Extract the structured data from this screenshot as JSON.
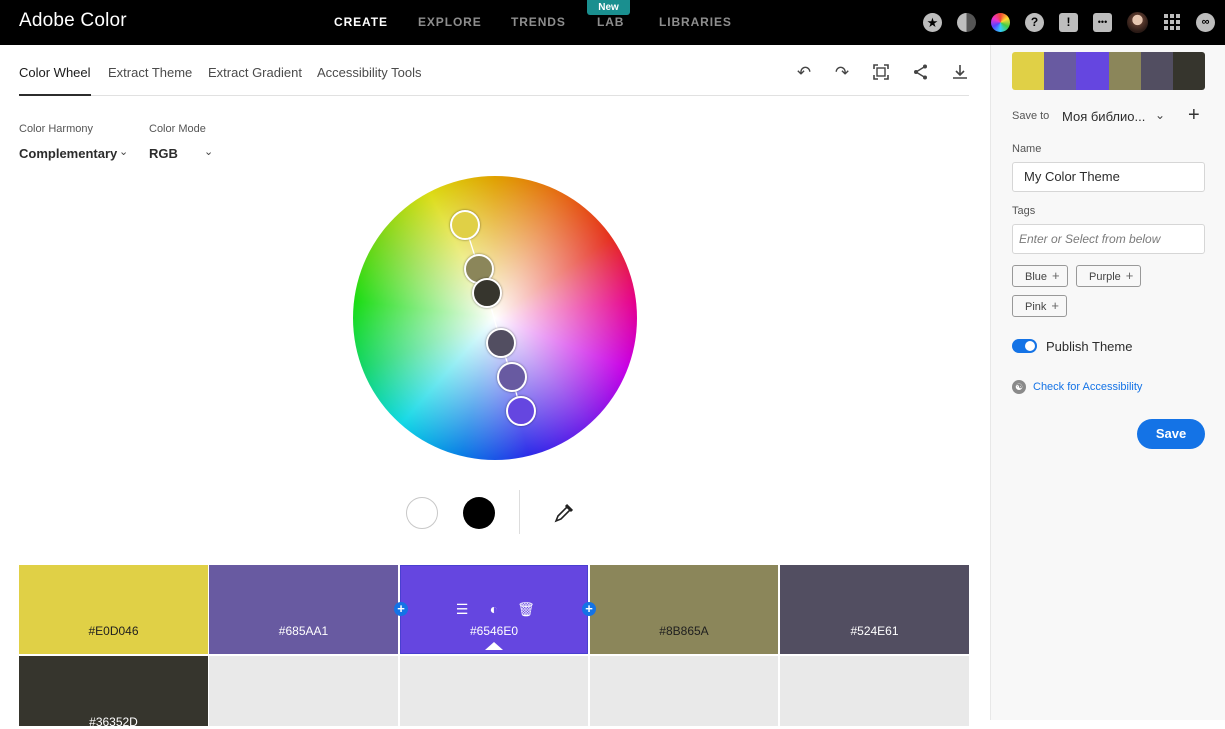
{
  "header": {
    "brand": "Adobe Color",
    "nav": [
      {
        "label": "CREATE",
        "active": true
      },
      {
        "label": "EXPLORE",
        "active": false
      },
      {
        "label": "TRENDS",
        "active": false
      },
      {
        "label": "LAB",
        "active": false
      },
      {
        "label": "LIBRARIES",
        "active": false
      }
    ],
    "new_badge": "New",
    "icons": [
      "star-icon",
      "moon-icon",
      "color-wheel-icon",
      "help-icon",
      "alert-icon",
      "chat-icon",
      "avatar",
      "apps-grid-icon",
      "creative-cloud-icon"
    ]
  },
  "tabs": [
    {
      "label": "Color Wheel",
      "active": true
    },
    {
      "label": "Extract Theme",
      "active": false
    },
    {
      "label": "Extract Gradient",
      "active": false
    },
    {
      "label": "Accessibility Tools",
      "active": false
    }
  ],
  "toolbar": [
    "undo-icon",
    "redo-icon",
    "fit-icon",
    "share-icon",
    "download-icon"
  ],
  "controls": {
    "harmony_label": "Color Harmony",
    "harmony_value": "Complementary",
    "mode_label": "Color Mode",
    "mode_value": "RGB"
  },
  "wheel_handles": [
    {
      "color": "#E0D046"
    },
    {
      "color": "#8B865A"
    },
    {
      "color": "#36352D"
    },
    {
      "color": "#524E61"
    },
    {
      "color": "#685AA1"
    },
    {
      "color": "#6546E0"
    }
  ],
  "palette": [
    {
      "hex": "#E0D046",
      "color": "#E0D046",
      "text_color": "#1f1f1f"
    },
    {
      "hex": "#685AA1",
      "color": "#685AA1",
      "text_color": "#ffffff"
    },
    {
      "hex": "#6546E0",
      "color": "#6546E0",
      "text_color": "#ffffff",
      "active": true
    },
    {
      "hex": "#8B865A",
      "color": "#8B865A",
      "text_color": "#1f1f1f"
    },
    {
      "hex": "#524E61",
      "color": "#524E61",
      "text_color": "#ffffff"
    },
    {
      "hex": "#36352D",
      "color": "#36352D",
      "text_color": "#ffffff"
    }
  ],
  "panel": {
    "save_to_label": "Save to",
    "save_to_value": "Моя библио...",
    "name_label": "Name",
    "name_value": "My Color Theme",
    "tags_label": "Tags",
    "tags_placeholder": "Enter or Select from below",
    "tags": [
      "Blue",
      "Purple",
      "Pink"
    ],
    "publish_label": "Publish Theme",
    "publish_on": true,
    "accessibility_link": "Check for Accessibility",
    "save_button": "Save"
  },
  "colors": {
    "accent": "#1473e6",
    "topbar": "#000000"
  }
}
